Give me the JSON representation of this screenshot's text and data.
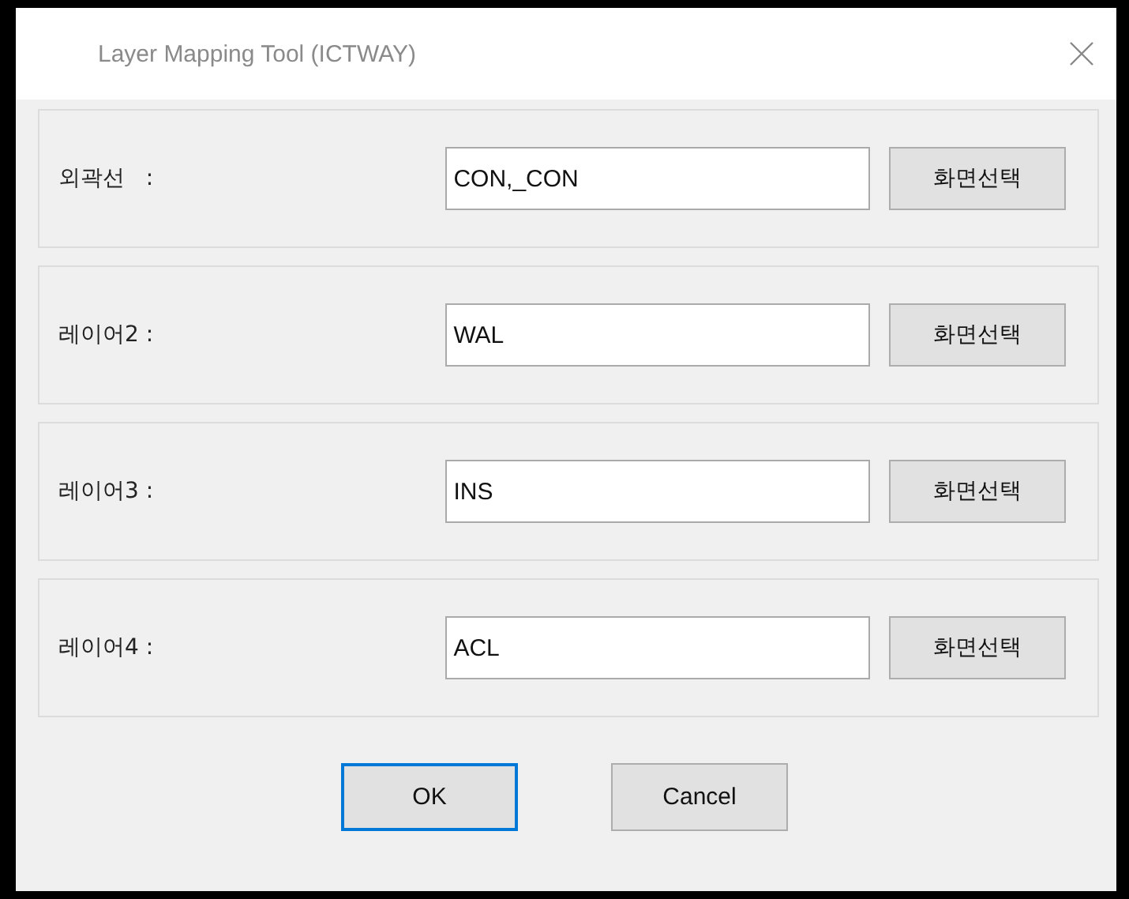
{
  "window": {
    "title": "Layer Mapping Tool (ICTWAY)"
  },
  "rows": [
    {
      "label": "외곽선   :",
      "value": "CON,_CON",
      "button": "화면선택"
    },
    {
      "label": "레이어2 :",
      "value": "WAL",
      "button": "화면선택"
    },
    {
      "label": "레이어3 :",
      "value": "INS",
      "button": "화면선택"
    },
    {
      "label": "레이어4 :",
      "value": "ACL",
      "button": "화면선택"
    }
  ],
  "buttons": [
    {
      "label": "OK",
      "default": true
    },
    {
      "label": "Cancel",
      "default": false
    }
  ]
}
